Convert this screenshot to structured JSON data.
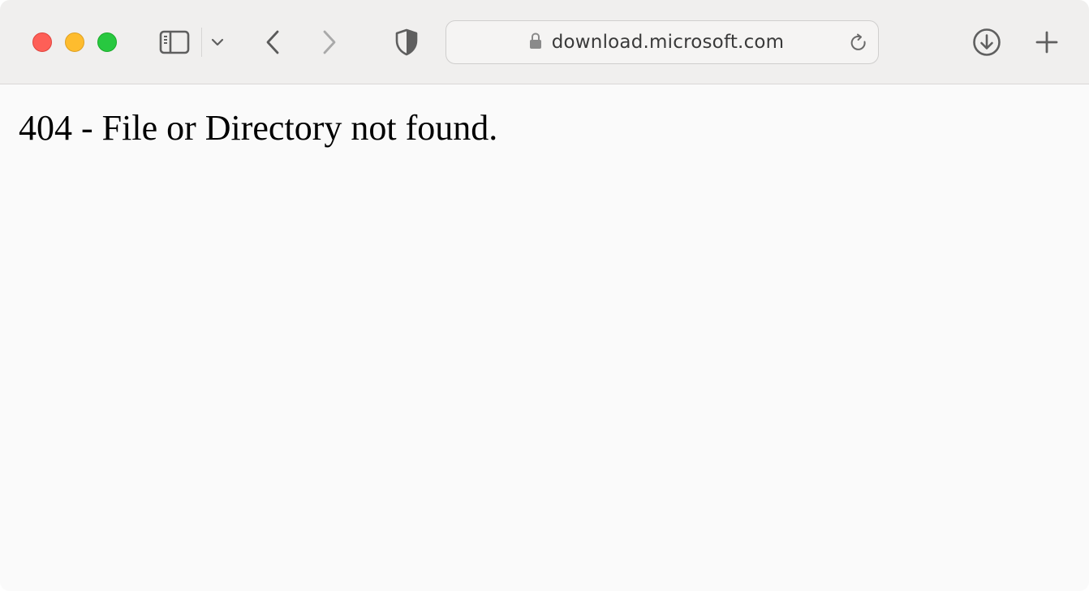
{
  "window": {
    "traffic_lights": [
      {
        "name": "close",
        "color": "#fe5f57"
      },
      {
        "name": "minimize",
        "color": "#febc2e"
      },
      {
        "name": "zoom",
        "color": "#28c840"
      }
    ]
  },
  "toolbar": {
    "icons": [
      "sidebar-icon",
      "chevron-down-icon",
      "back-icon",
      "forward-icon",
      "shield-icon",
      "lock-icon",
      "reload-icon",
      "download-icon",
      "new-tab-icon"
    ],
    "address": "download.microsoft.com"
  },
  "page": {
    "message": "404 - File or Directory not found."
  }
}
